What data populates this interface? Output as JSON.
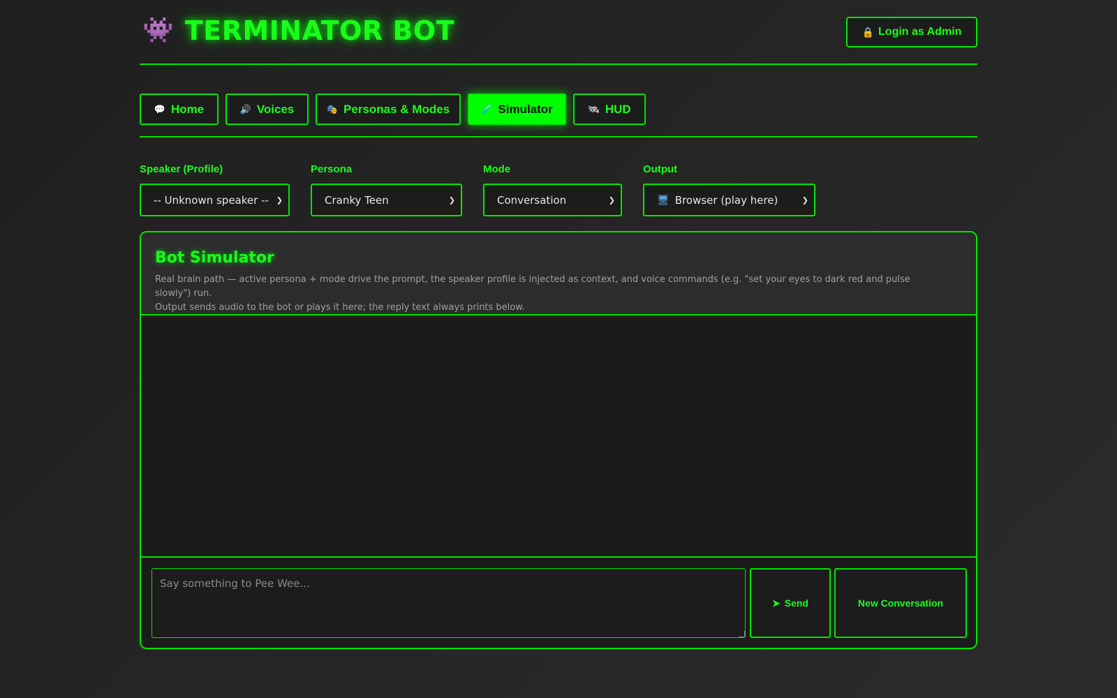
{
  "app": {
    "icon": "alien-monster-icon",
    "title": "TERMINATOR BOT",
    "login_label": "Login as Admin",
    "login_icon": "lock-icon"
  },
  "tabs": [
    {
      "label": "Home",
      "icon": "speech-bubble-icon",
      "active": false
    },
    {
      "label": "Voices",
      "icon": "speaker-icon",
      "active": false
    },
    {
      "label": "Personas & Modes",
      "icon": "theater-masks-icon",
      "active": false
    },
    {
      "label": "Simulator",
      "icon": "test-tube-icon",
      "active": true
    },
    {
      "label": "HUD",
      "icon": "satellite-icon",
      "active": false
    }
  ],
  "controls": {
    "speaker": {
      "label": "Speaker (Profile)",
      "value": "-- Unknown speaker --"
    },
    "persona": {
      "label": "Persona",
      "value": "Cranky Teen"
    },
    "mode": {
      "label": "Mode",
      "value": "Conversation"
    },
    "output": {
      "label": "Output",
      "value": "Browser (play here)",
      "icon": "computer-icon"
    }
  },
  "simulator": {
    "title": "Bot Simulator",
    "description_line1": "Real brain path — active persona + mode drive the prompt, the speaker profile is injected as context, and voice commands (e.g. \"set your eyes to dark red and pulse slowly\") run.",
    "description_line2": "Output sends audio to the bot or plays it here; the reply text always prints below.",
    "input_placeholder": "Say something to Pee Wee...",
    "send_label": "Send",
    "new_conversation_label": "New Conversation"
  },
  "colors": {
    "accent": "#00ff00",
    "background": "#232323",
    "panel_header": "#2c2c2c",
    "muted_text": "#a0a0a0"
  }
}
